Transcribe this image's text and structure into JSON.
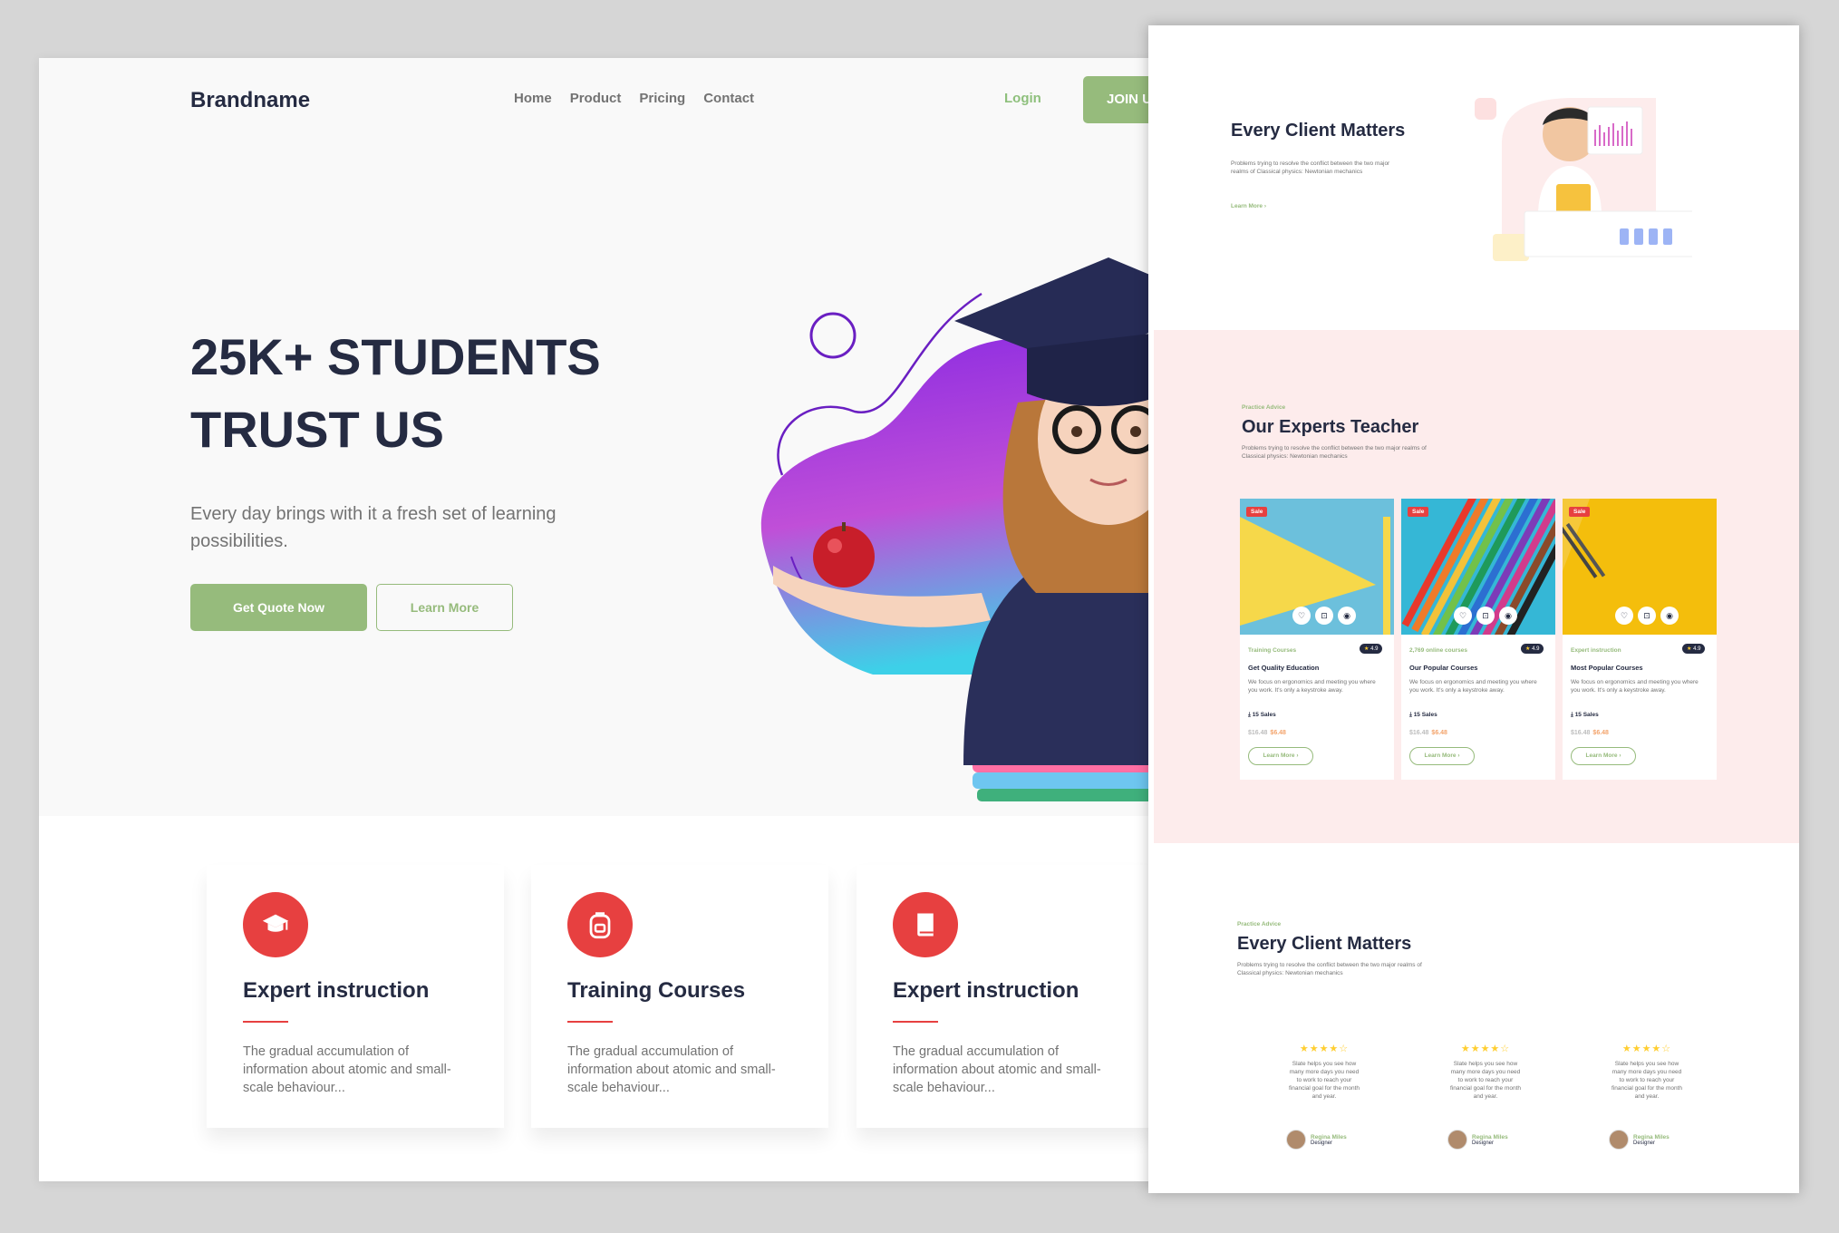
{
  "left_page": {
    "brand": "Brandname",
    "nav": [
      {
        "label": "Home"
      },
      {
        "label": "Product"
      },
      {
        "label": "Pricing"
      },
      {
        "label": "Contact"
      }
    ],
    "login_label": "Login",
    "join_label": "JOIN US",
    "hero": {
      "title_line1": "25K+ STUDENTS",
      "title_line2": "TRUST US",
      "subtitle": "Every day brings with it a fresh set of learning possibilities.",
      "primary_button": "Get Quote Now",
      "secondary_button": "Learn More"
    },
    "features": [
      {
        "icon": "graduation-cap-icon",
        "title": "Expert instruction",
        "desc": "The gradual accumulation of information about atomic and small-scale behaviour..."
      },
      {
        "icon": "backpack-icon",
        "title": "Training Courses",
        "desc": "The gradual accumulation of information about atomic and small-scale behaviour..."
      },
      {
        "icon": "book-icon",
        "title": "Expert instruction",
        "desc": "The gradual accumulation of information about atomic and small-scale behaviour..."
      }
    ]
  },
  "right_page": {
    "section1": {
      "title": "Every Client Matters",
      "desc": "Problems trying to resolve the conflict between the two major realms of Classical physics: Newtonian mechanics",
      "link": "Learn More"
    },
    "section2": {
      "tag": "Practice Advice",
      "title": "Our Experts Teacher",
      "desc": "Problems trying to resolve the conflict between the two major realms of Classical physics: Newtonian mechanics",
      "courses": [
        {
          "sale": "Sale",
          "category": "Training Courses",
          "rating": "4.9",
          "title": "Get Quality Education",
          "desc": "We focus on ergonomics and meeting you where you work. It's only a keystroke away.",
          "sales": "15 Sales",
          "old_price": "$16.48",
          "new_price": "$6.48",
          "button": "Learn More"
        },
        {
          "sale": "Sale",
          "category": "2,769 online courses",
          "rating": "4.9",
          "title": "Our Popular Courses",
          "desc": "We focus on ergonomics and meeting you where you work. It's only a keystroke away.",
          "sales": "15 Sales",
          "old_price": "$16.48",
          "new_price": "$6.48",
          "button": "Learn More"
        },
        {
          "sale": "Sale",
          "category": "Expert instruction",
          "rating": "4.9",
          "title": "Most Popular Courses",
          "desc": "We focus on ergonomics and meeting you where you work. It's only a keystroke away.",
          "sales": "15 Sales",
          "old_price": "$16.48",
          "new_price": "$6.48",
          "button": "Learn More"
        }
      ]
    },
    "section3": {
      "tag": "Practice Advice",
      "title": "Every Client Matters",
      "desc": "Problems trying to resolve the conflict between the two major realms of Classical physics: Newtonian mechanics",
      "testimonials": [
        {
          "stars": "★★★★☆",
          "text": "Slate helps you see how many more days you need to work to reach your financial goal for the month and year.",
          "name": "Regina Miles",
          "role": "Designer"
        },
        {
          "stars": "★★★★☆",
          "text": "Slate helps you see how many more days you need to work to reach your financial goal for the month and year.",
          "name": "Regina Miles",
          "role": "Designer"
        },
        {
          "stars": "★★★★☆",
          "text": "Slate helps you see how many more days you need to work to reach your financial goal for the month and year.",
          "name": "Regina Miles",
          "role": "Designer"
        }
      ]
    }
  },
  "colors": {
    "accent_green": "#96bb7c",
    "dark_navy": "#252b42",
    "red": "#e74040",
    "pink_bg": "#fdecec"
  }
}
